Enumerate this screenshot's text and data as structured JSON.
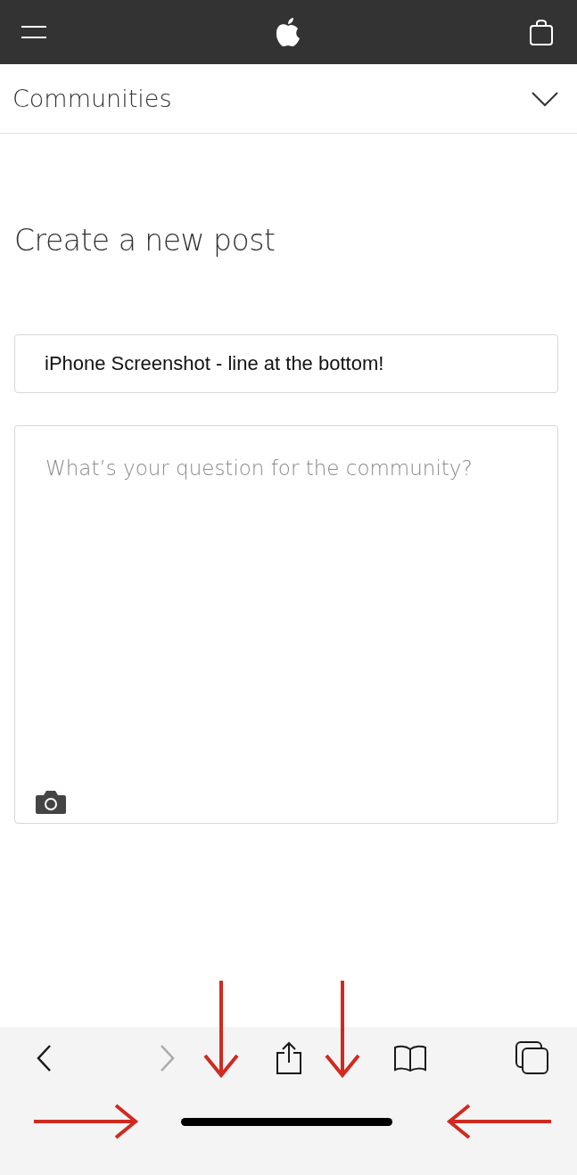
{
  "nav": {
    "title": "Communities"
  },
  "heading": "Create a new post",
  "subject_field": {
    "value": "iPhone Screenshot - line at the bottom!"
  },
  "body_field": {
    "placeholder": "What’s your question for the community?"
  },
  "toolbar": [
    {
      "kind": "back",
      "disabled": false
    },
    {
      "kind": "forward",
      "disabled": true
    },
    {
      "kind": "share",
      "disabled": false
    },
    {
      "kind": "bookmarks",
      "disabled": false
    },
    {
      "kind": "tabs",
      "disabled": false
    }
  ]
}
